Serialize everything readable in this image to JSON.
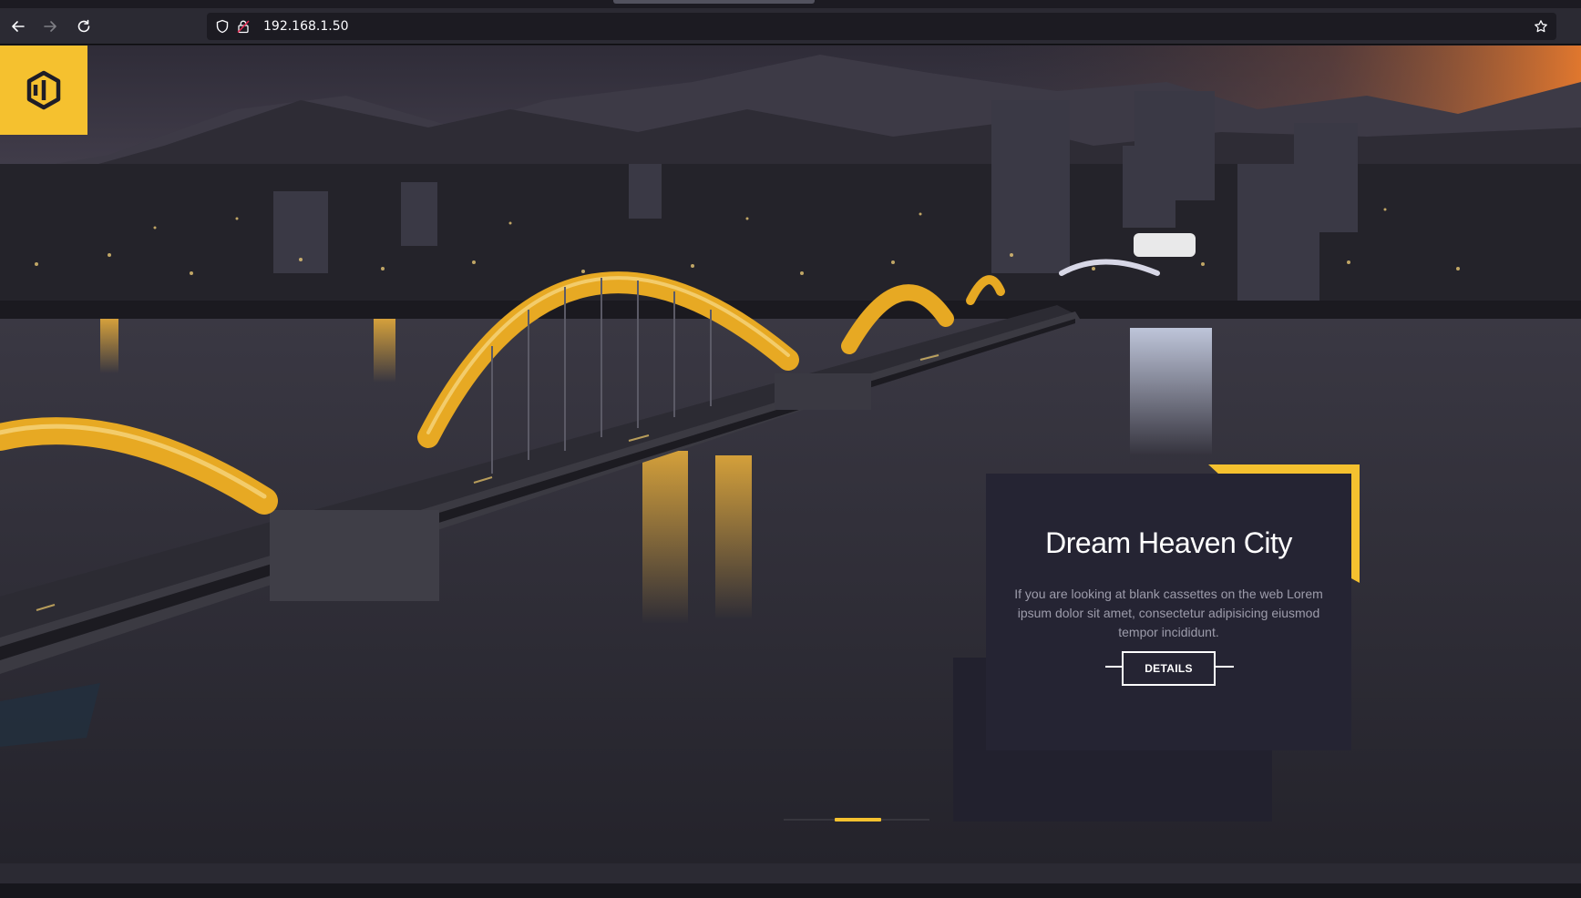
{
  "browser": {
    "url": "192.168.1.50",
    "icons": {
      "back": "back-arrow-icon",
      "forward": "forward-arrow-icon",
      "reload": "reload-icon",
      "shield": "shield-icon",
      "lock": "insecure-lock-icon",
      "bookmark": "star-icon"
    }
  },
  "site": {
    "logo_icon": "hexagon-logo-icon",
    "accent_color": "#f5c12f",
    "card_color": "#252433"
  },
  "hero": {
    "title": "Dream Heaven City",
    "description": "If you are looking at blank cassettes on the web Lorem ipsum dolor sit amet, consectetur adipisicing eiusmod tempor incididunt.",
    "button_label": "DETAILS",
    "active_slide": 2,
    "slide_count": 3
  }
}
